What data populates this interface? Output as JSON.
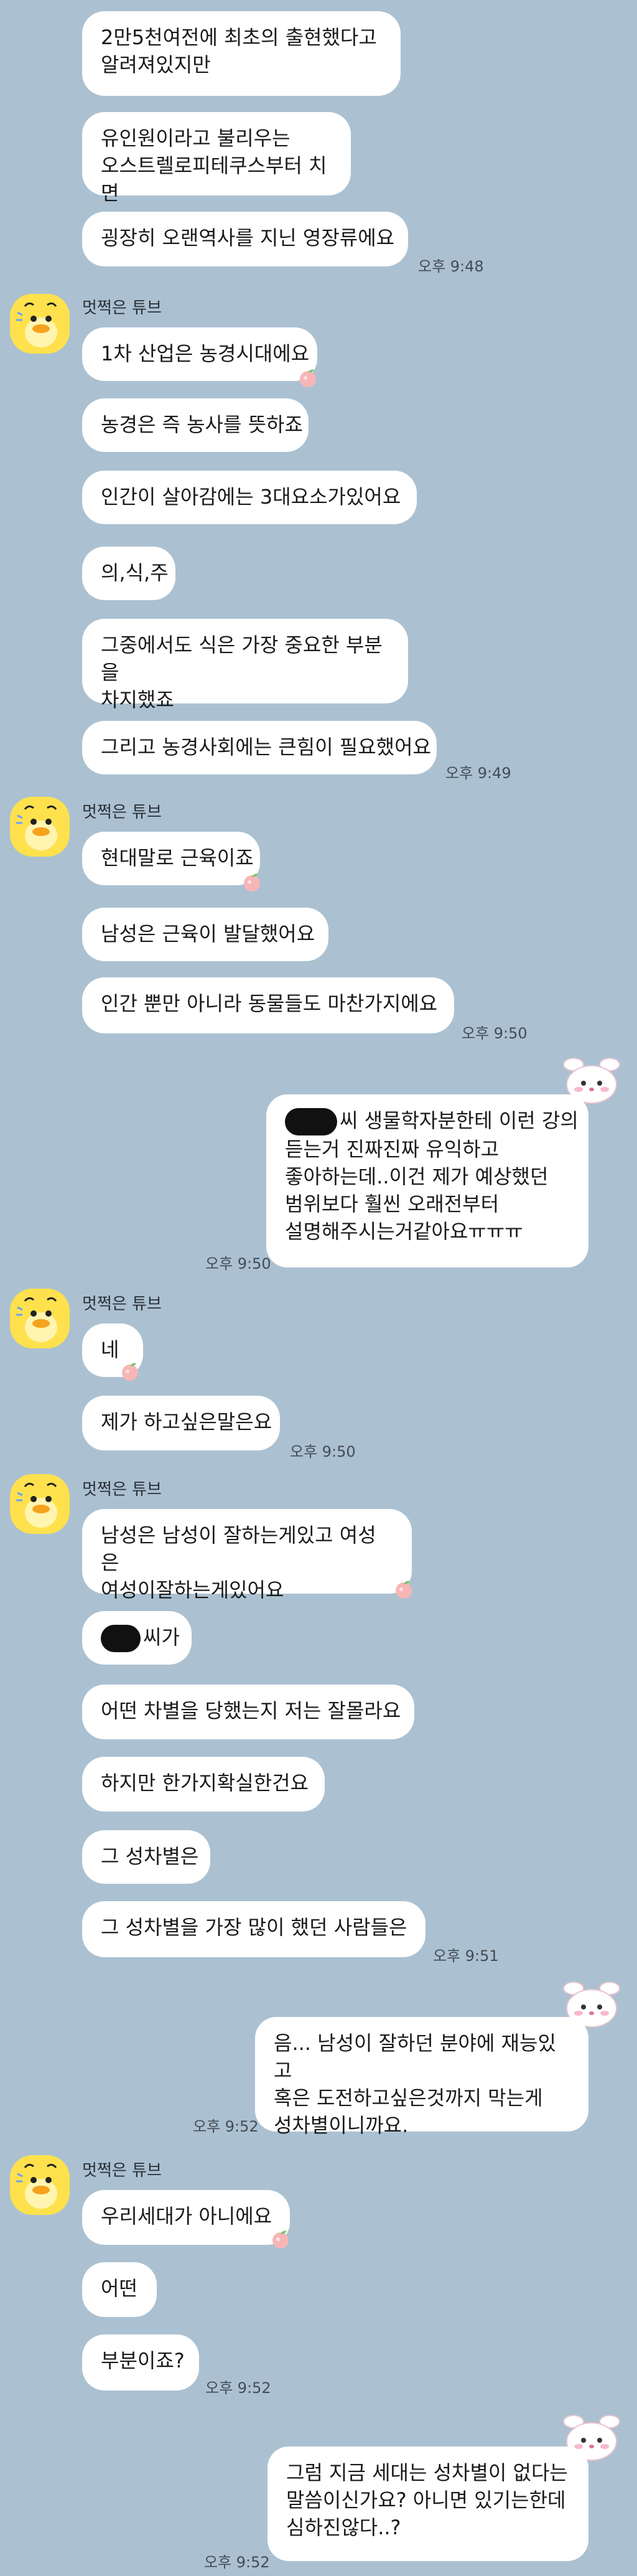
{
  "messages": {
    "m1": "2만5천여전에 최초의 출현했다고\n알려져있지만",
    "m2": "유인원이라고 불리우는\n오스트렐로피테쿠스부터 치면",
    "m3": "굉장히 오랜역사를 지닌 영장류에요",
    "t1": "오후 9:48",
    "sender": "멋쩍은 튜브",
    "m4": "1차 산업은 농경시대에요",
    "m5": "농경은 즉 농사를 뜻하죠",
    "m6": "인간이 살아감에는 3대요소가있어요",
    "m7": "의,식,주",
    "m8": "그중에서도 식은 가장 중요한 부분을\n차지했죠",
    "m9": "그리고 농경사회에는 큰힘이 필요했어요",
    "t2": "오후 9:49",
    "m10": "현대말로 근육이죠",
    "m11": "남성은 근육이 발달했어요",
    "m12": "인간 뿐만 아니라 동물들도 마찬가지에요",
    "t3": "오후 9:50",
    "me1_after": "씨 생물학자분한테 이런 강의",
    "me1_rest": "듣는거 진짜진짜 유익하고\n좋아하는데..이건 제가 예상했던\n범위보다 훨씬 오래전부터\n설명해주시는거같아요ㅠㅠㅠ",
    "t4": "오후 9:50",
    "m13": "네",
    "m14": "제가 하고싶은말은요",
    "t5": "오후 9:50",
    "m15": "남성은 남성이 잘하는게있고 여성은\n여성이잘하는게있어요",
    "m16_after": "씨가",
    "m17": "어떤 차별을 당했는지 저는 잘몰라요",
    "m18": "하지만 한가지확실한건요",
    "m19": "그 성차별은",
    "m20": "그 성차별을 가장 많이 했던 사람들은",
    "t6": "오후 9:51",
    "me2": "음... 남성이 잘하던 분야에 재능있고\n혹은 도전하고싶은것까지 막는게\n성차별이니까요.",
    "t7": "오후 9:52",
    "m21": "우리세대가 아니에요",
    "m22": "어떤",
    "m23": "부분이죠?",
    "t8": "오후 9:52",
    "me3": "그럼 지금 세대는 성차별이 없다는\n말씀이신가요? 아니면 있기는한데\n심하진않다..?",
    "t9": "오후 9:52"
  },
  "icons": {
    "avatar": "tube-duck-avatar",
    "sticker": "bunny-sticker",
    "reaction": "peach-heart-icon"
  },
  "colors": {
    "background": "#abc1d1",
    "bubble": "#ffffff",
    "avatar": "#ffe14d"
  }
}
